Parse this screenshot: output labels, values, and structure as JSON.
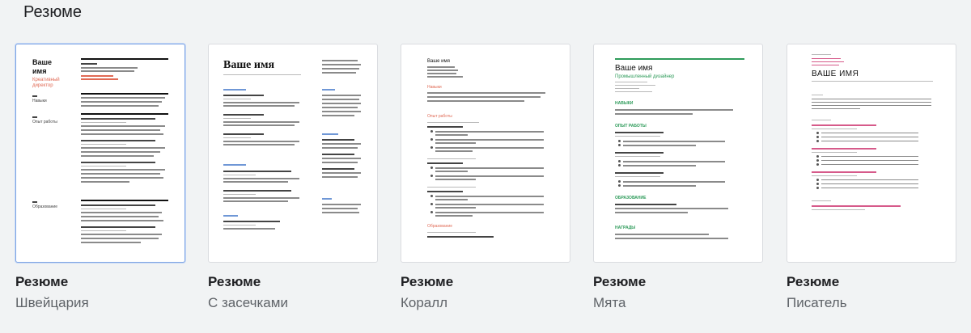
{
  "section": {
    "title": "Резюме"
  },
  "colors": {
    "selected_border": "#7fa5e3",
    "coral_accent": "#e06a55",
    "mint_accent": "#2e9b5a",
    "serif_accent": "#6f97d6",
    "writer_accent": "#d65a8a"
  },
  "templates": [
    {
      "title": "Резюме",
      "subtitle": "Швейцария",
      "preview": {
        "name_line1": "Ваше",
        "name_line2": "имя",
        "role_line1": "Креативный",
        "role_line2": "директор",
        "label_skills": "Навыки",
        "label_experience": "Опыт работы",
        "label_education": "Образование"
      }
    },
    {
      "title": "Резюме",
      "subtitle": "С засечками",
      "preview": {
        "name": "Ваше имя"
      }
    },
    {
      "title": "Резюме",
      "subtitle": "Коралл",
      "preview": {
        "name": "Ваше имя",
        "section_skills": "Навыки",
        "section_experience": "Опыт работы",
        "section_education": "Образование"
      }
    },
    {
      "title": "Резюме",
      "subtitle": "Мята",
      "preview": {
        "name": "Ваше имя",
        "role": "Промышленный дизайнер",
        "section_skills": "НАВЫКИ",
        "section_experience": "ОПЫТ РАБОТЫ",
        "section_education": "ОБРАЗОВАНИЕ",
        "section_awards": "НАГРАДЫ"
      }
    },
    {
      "title": "Резюме",
      "subtitle": "Писатель",
      "preview": {
        "name": "ВАШЕ ИМЯ"
      }
    }
  ]
}
